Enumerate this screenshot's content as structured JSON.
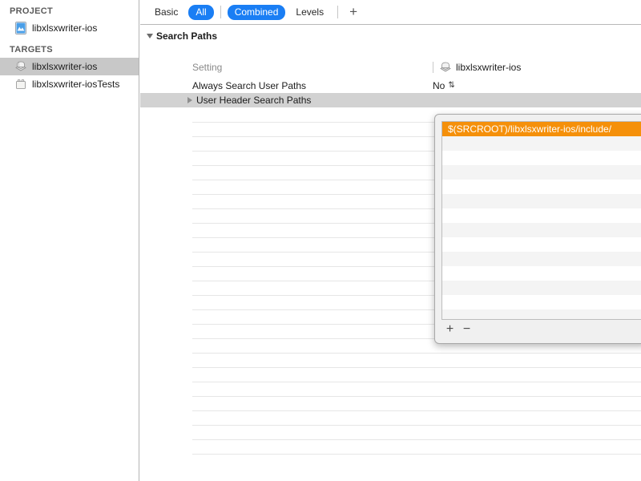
{
  "sidebar": {
    "project_group_label": "PROJECT",
    "project_items": [
      {
        "label": "libxlsxwriter-ios",
        "icon": "xcode-project-icon"
      }
    ],
    "targets_group_label": "TARGETS",
    "target_items": [
      {
        "label": "libxlsxwriter-ios",
        "icon": "library-target-icon",
        "selected": true
      },
      {
        "label": "libxlsxwriter-iosTests",
        "icon": "test-bundle-target-icon",
        "selected": false
      }
    ]
  },
  "toolbar": {
    "tabs": [
      {
        "label": "Basic",
        "active": false
      },
      {
        "label": "All",
        "active": true
      },
      {
        "label": "Combined",
        "active": true
      },
      {
        "label": "Levels",
        "active": false
      }
    ],
    "add_label": "+"
  },
  "settings": {
    "section_title": "Search Paths",
    "column_setting_label": "Setting",
    "column_target_label": "libxlsxwriter-ios",
    "rows": [
      {
        "name": "Always Search User Paths",
        "value": "No",
        "stepper": "⇅",
        "expandable": false,
        "selected": false
      },
      {
        "name": "User Header Search Paths",
        "value": "",
        "stepper": "",
        "expandable": true,
        "selected": true
      }
    ]
  },
  "popover": {
    "entries": [
      {
        "value": "$(SRCROOT)/libxlsxwriter-ios/include/",
        "selected": true
      },
      {
        "value": "",
        "selected": false
      },
      {
        "value": "",
        "selected": false
      },
      {
        "value": "",
        "selected": false
      },
      {
        "value": "",
        "selected": false
      },
      {
        "value": "",
        "selected": false
      },
      {
        "value": "",
        "selected": false
      },
      {
        "value": "",
        "selected": false
      },
      {
        "value": "",
        "selected": false
      },
      {
        "value": "",
        "selected": false
      },
      {
        "value": "",
        "selected": false
      },
      {
        "value": "",
        "selected": false
      },
      {
        "value": "",
        "selected": false
      },
      {
        "value": "",
        "selected": false
      }
    ],
    "add_label": "+",
    "remove_label": "−"
  },
  "colors": {
    "accent_blue": "#1a7ef4",
    "selection_orange": "#f5900a",
    "row_selected_gray": "#d2d2d2",
    "sidebar_selected_gray": "#c8c8c8"
  }
}
